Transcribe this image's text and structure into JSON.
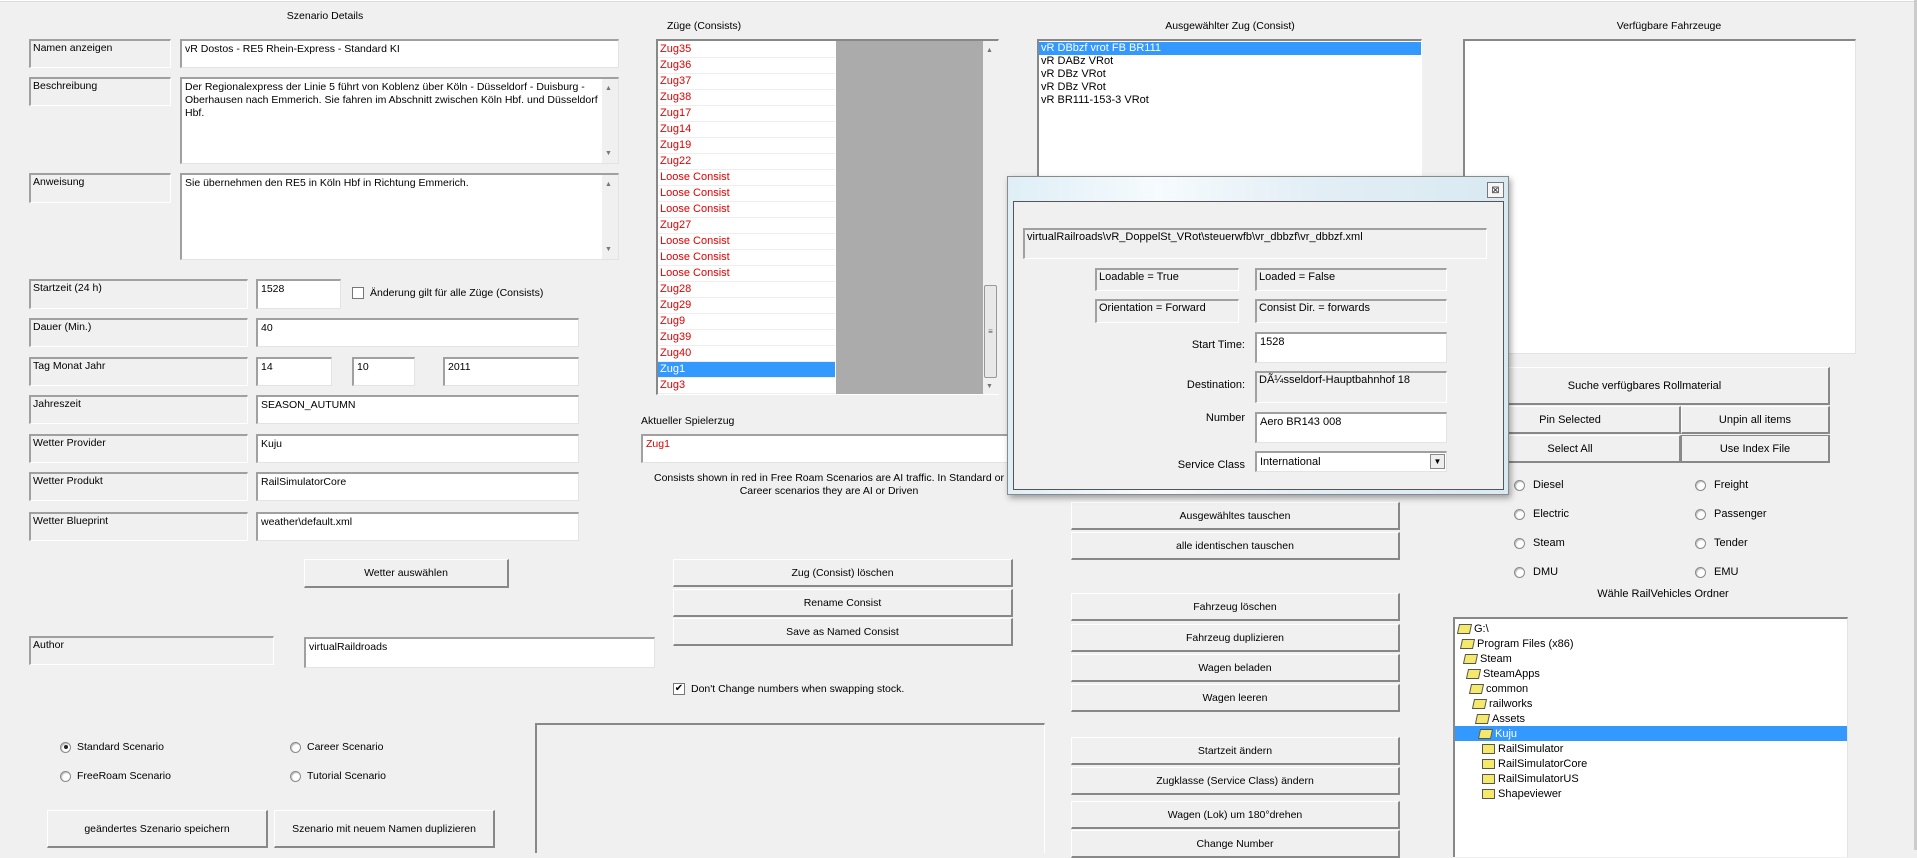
{
  "scenario": {
    "title": "Szenario Details",
    "name_label": "Namen anzeigen",
    "name_value": "vR Dostos - RE5 Rhein-Express - Standard KI",
    "desc_label": "Beschreibung",
    "desc_value": "Der Regionalexpress der Linie 5 führt von Koblenz über Köln - Düsseldorf - Duisburg - Oberhausen nach Emmerich. Sie fahren im Abschnitt zwischen Köln Hbf. und Düsseldorf Hbf.",
    "instr_label": "Anweisung",
    "instr_value": "Sie übernehmen den RE5 in Köln Hbf in Richtung Emmerich.",
    "start_label": "Startzeit (24 h)",
    "start_value": "1528",
    "apply_all_label": "Änderung gilt für alle Züge (Consists)",
    "apply_all_checked": false,
    "duration_label": "Dauer (Min.)",
    "duration_value": "40",
    "date_label": "Tag Monat Jahr",
    "day": "14",
    "month": "10",
    "year": "2011",
    "season_label": "Jahreszeit",
    "season_value": "SEASON_AUTUMN",
    "wprov_label": "Wetter Provider",
    "wprov_value": "Kuju",
    "wprod_label": "Wetter Produkt",
    "wprod_value": "RailSimulatorCore",
    "wbp_label": "Wetter Blueprint",
    "wbp_value": "weather\\default.xml",
    "weather_button": "Wetter auswählen",
    "author_label": "Author",
    "author_value": "virtualRaildroads",
    "types": [
      {
        "label": "Standard Scenario",
        "checked": true
      },
      {
        "label": "Career Scenario",
        "checked": false
      },
      {
        "label": "FreeRoam Scenario",
        "checked": false
      },
      {
        "label": "Tutorial Scenario",
        "checked": false
      }
    ],
    "save_button": "geändertes Szenario speichern",
    "duplicate_button": "Szenario mit neuem Namen duplizieren"
  },
  "consists": {
    "title": "Züge (Consists)",
    "items": [
      "Zug35",
      "Zug36",
      "Zug37",
      "Zug38",
      "Zug17",
      "Zug14",
      "Zug19",
      "Zug22",
      "Loose Consist",
      "Loose Consist",
      "Loose Consist",
      "Zug27",
      "Loose Consist",
      "Loose Consist",
      "Loose Consist",
      "Zug28",
      "Zug29",
      "Zug9",
      "Zug39",
      "Zug40",
      "Zug1",
      "Zug3"
    ],
    "selected_index": 20,
    "player_label": "Aktueller Spielerzug",
    "player_value": "Zug1",
    "note": "Consists shown in red in Free Roam Scenarios are AI traffic. In Standard or Career scenarios they are AI or Driven",
    "delete_button": "Zug (Consist) löschen",
    "rename_button": "Rename Consist",
    "save_named_button": "Save as Named Consist",
    "keep_numbers_label": "Don't Change numbers when swapping stock.",
    "keep_numbers_checked": true
  },
  "selected_consist": {
    "title": "Ausgewählter Zug (Consist)",
    "items": [
      "vR DBbzf vrot FB BR111",
      "vR DABz VRot",
      "vR DBz VRot",
      "vR DBz VRot",
      "vR BR111-153-3 VRot"
    ],
    "selected_index": 0,
    "buttons": [
      "Ausgewähltes tauschen",
      "alle identischen tauschen",
      "Fahrzeug löschen",
      "Fahrzeug duplizieren",
      "Wagen beladen",
      "Wagen leeren",
      "Startzeit ändern",
      "Zugklasse (Service Class) ändern",
      "Wagen (Lok) um 180°drehen",
      "Change Number"
    ]
  },
  "dialog": {
    "path": "virtualRailroads\\vR_DoppelSt_VRot\\steuerwfb\\vr_dbbzf\\vr_dbbzf.xml",
    "loadable": "Loadable = True",
    "loaded": "Loaded = False",
    "orientation": "Orientation = Forward",
    "consist_dir": "Consist Dir. = forwards",
    "start_label": "Start Time:",
    "start_value": "1528",
    "dest_label": "Destination:",
    "dest_value": "DÃ¼sseldorf-Hauptbahnhof 18",
    "number_label": "Number",
    "number_value": "Aero BR143 008",
    "class_label": "Service Class",
    "class_value": "International"
  },
  "available": {
    "title": "Verfügbare Fahrzeuge",
    "search_button": "Suche verfügbares Rollmaterial",
    "pin_button": "Pin Selected",
    "unpin_button": "Unpin all items",
    "select_all_button": "Select All",
    "index_button": "Use Index File",
    "filters": [
      "Diesel",
      "Freight",
      "Electric",
      "Passenger",
      "Steam",
      "Tender",
      "DMU",
      "EMU"
    ],
    "folder_title": "Wähle RailVehicles Ordner",
    "tree": [
      {
        "label": "G:\\",
        "level": 0,
        "open": true
      },
      {
        "label": "Program Files (x86)",
        "level": 1,
        "open": true
      },
      {
        "label": "Steam",
        "level": 2,
        "open": true
      },
      {
        "label": "SteamApps",
        "level": 3,
        "open": true
      },
      {
        "label": "common",
        "level": 4,
        "open": true
      },
      {
        "label": "railworks",
        "level": 5,
        "open": true
      },
      {
        "label": "Assets",
        "level": 6,
        "open": true
      },
      {
        "label": "Kuju",
        "level": 7,
        "open": true,
        "selected": true
      },
      {
        "label": "RailSimulator",
        "level": 8,
        "open": false
      },
      {
        "label": "RailSimulatorCore",
        "level": 8,
        "open": false
      },
      {
        "label": "RailSimulatorUS",
        "level": 8,
        "open": false
      },
      {
        "label": "Shapeviewer",
        "level": 8,
        "open": false
      }
    ]
  },
  "colors": {
    "selection": "#3399ff",
    "ai_text": "#e00000",
    "face": "#f0f0f0"
  }
}
